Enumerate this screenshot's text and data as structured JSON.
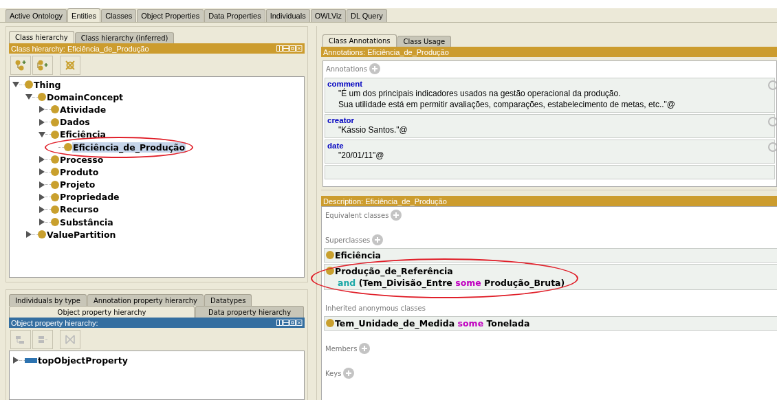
{
  "main_tabs": [
    {
      "label": "Active Ontology",
      "selected": false
    },
    {
      "label": "Entities",
      "selected": true
    },
    {
      "label": "Classes",
      "selected": false
    },
    {
      "label": "Object Properties",
      "selected": false
    },
    {
      "label": "Data Properties",
      "selected": false
    },
    {
      "label": "Individuals",
      "selected": false
    },
    {
      "label": "OWLViz",
      "selected": false
    },
    {
      "label": "DL Query",
      "selected": false
    }
  ],
  "class_panel": {
    "tabs": [
      {
        "label": "Class hierarchy",
        "selected": true
      },
      {
        "label": "Class hierarchy (inferred)",
        "selected": false
      }
    ],
    "title": "Class hierarchy: Eficiência_de_Produção",
    "tree": [
      {
        "label": "Thing",
        "leaf": false,
        "expanded": true,
        "selected": false,
        "circled": false,
        "children": [
          {
            "label": "DomainConcept",
            "leaf": false,
            "expanded": true,
            "selected": false,
            "circled": false,
            "children": [
              {
                "label": "Atividade",
                "leaf": false,
                "expanded": false,
                "selected": false,
                "circled": false
              },
              {
                "label": "Dados",
                "leaf": false,
                "expanded": false,
                "selected": false,
                "circled": false
              },
              {
                "label": "Eficiência",
                "leaf": false,
                "expanded": true,
                "selected": false,
                "circled": false,
                "children": [
                  {
                    "label": "Eficiência_de_Produção",
                    "leaf": true,
                    "expanded": false,
                    "selected": true,
                    "circled": true
                  }
                ]
              },
              {
                "label": "Processo",
                "leaf": false,
                "expanded": false,
                "selected": false,
                "circled": false
              },
              {
                "label": "Produto",
                "leaf": false,
                "expanded": false,
                "selected": false,
                "circled": false
              },
              {
                "label": "Projeto",
                "leaf": false,
                "expanded": false,
                "selected": false,
                "circled": false
              },
              {
                "label": "Propriedade",
                "leaf": false,
                "expanded": false,
                "selected": false,
                "circled": false
              },
              {
                "label": "Recurso",
                "leaf": false,
                "expanded": false,
                "selected": false,
                "circled": false
              },
              {
                "label": "Substância",
                "leaf": false,
                "expanded": false,
                "selected": false,
                "circled": false
              }
            ]
          },
          {
            "label": "ValuePartition",
            "leaf": false,
            "expanded": false,
            "selected": false,
            "circled": false
          }
        ]
      }
    ]
  },
  "property_panel": {
    "tab_rows": [
      [
        {
          "label": "Individuals by type",
          "selected": false
        },
        {
          "label": "Annotation property hierarchy",
          "selected": false
        },
        {
          "label": "Datatypes",
          "selected": false
        }
      ],
      [
        {
          "label": "Object property hierarchy",
          "selected": true
        },
        {
          "label": "Data property hierarchy",
          "selected": false
        }
      ]
    ],
    "title": "Object property hierarchy:",
    "tree": [
      {
        "label": "topObjectProperty",
        "leaf": false,
        "expanded": false,
        "selected": false
      }
    ]
  },
  "annotations_panel": {
    "tabs": [
      {
        "label": "Class Annotations",
        "selected": true
      },
      {
        "label": "Class Usage",
        "selected": false
      }
    ],
    "title": "Annotations: Eficiência_de_Produção",
    "section_label": "Annotations",
    "items": [
      {
        "property": "comment",
        "lines": [
          "\"É um dos principais indicadores usados na gestão operacional da produção.",
          "Sua utilidade está em permitir avaliações, comparações, estabelecimento de metas, etc..\"@"
        ]
      },
      {
        "property": "creator",
        "lines": [
          "\"Kássio Santos.\"@"
        ]
      },
      {
        "property": "date",
        "lines": [
          "\"20/01/11\"@"
        ]
      }
    ]
  },
  "description_panel": {
    "title": "Description: Eficiência_de_Produção",
    "sections": [
      {
        "label": "Equivalent classes",
        "addable": true
      },
      {
        "label": "Superclasses",
        "addable": true,
        "items": [
          {
            "circled": false,
            "lines": [
              [
                {
                  "kind": "name",
                  "text": "Eficiência"
                }
              ]
            ]
          },
          {
            "circled": true,
            "lines": [
              [
                {
                  "kind": "name",
                  "text": "Produção_de_Referência"
                }
              ],
              [
                {
                  "kind": "connective",
                  "text": "and"
                },
                {
                  "kind": "name",
                  "text": "(Tem_Divisão_Entre"
                },
                {
                  "kind": "quantifier",
                  "text": "some"
                },
                {
                  "kind": "name",
                  "text": "Produção_Bruta)"
                }
              ]
            ]
          }
        ]
      },
      {
        "label": "Inherited anonymous classes",
        "addable": false,
        "items": [
          {
            "circled": false,
            "lines": [
              [
                {
                  "kind": "name",
                  "text": "Tem_Unidade_de_Medida"
                },
                {
                  "kind": "quantifier",
                  "text": "some"
                },
                {
                  "kind": "name",
                  "text": "Tonelada"
                }
              ]
            ]
          }
        ]
      },
      {
        "label": "Members",
        "addable": true
      },
      {
        "label": "Keys",
        "addable": true
      }
    ]
  }
}
